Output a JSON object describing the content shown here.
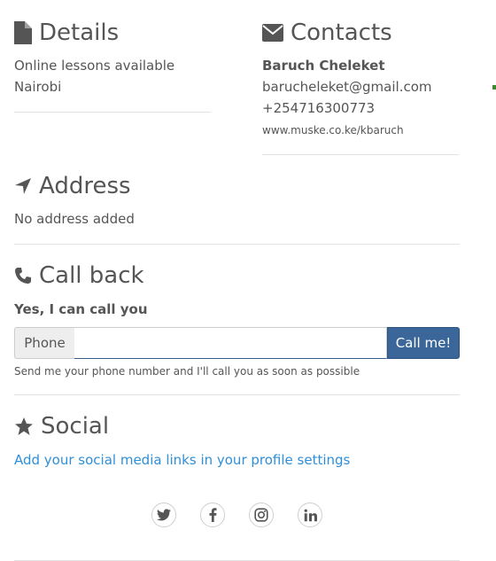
{
  "details": {
    "heading": "Details",
    "line1": "Online lessons available",
    "line2": "Nairobi"
  },
  "contacts": {
    "heading": "Contacts",
    "name": "Baruch Cheleket",
    "email": "barucheleket@gmail.com",
    "phone": "+254716300773",
    "website": "www.muske.co.ke/kbaruch"
  },
  "address": {
    "heading": "Address",
    "text": "No address added"
  },
  "callback": {
    "heading": "Call back",
    "subheading": "Yes, I can call you",
    "addon_label": "Phone",
    "input_value": "",
    "input_placeholder": "",
    "button_label": "Call me!",
    "help_text": "Send me your phone number and I'll call you as soon as possible"
  },
  "social": {
    "heading": "Social",
    "link_text": "Add your social media links in your profile settings",
    "icons": [
      "twitter-icon",
      "facebook-icon",
      "instagram-icon",
      "linkedin-icon"
    ]
  },
  "colors": {
    "text": "#555555",
    "link": "#2f8fd8",
    "button": "#3b6699",
    "divider": "#e2e2e2"
  }
}
